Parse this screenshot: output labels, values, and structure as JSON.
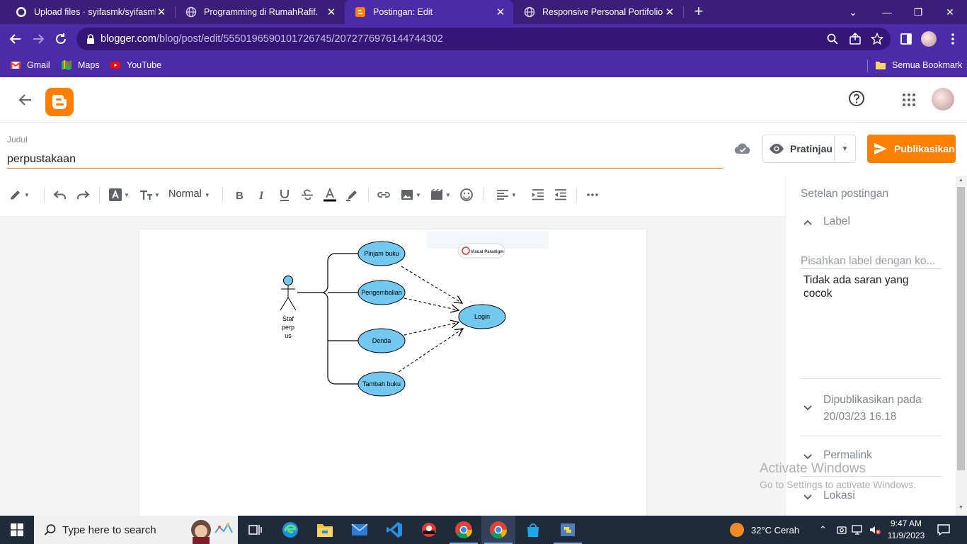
{
  "browser": {
    "tabs": [
      {
        "title": "Upload files · syifasmk/syifasmk",
        "icon": "github-icon",
        "active": false
      },
      {
        "title": "Programming di RumahRafif.",
        "icon": "globe-icon",
        "active": false
      },
      {
        "title": "Postingan: Edit",
        "icon": "blogger-icon",
        "active": true
      },
      {
        "title": "Responsive Personal Portifolio W",
        "icon": "globe-icon",
        "active": false
      }
    ],
    "url_host": "blogger.com",
    "url_path": "/blog/post/edit/5550196590101726745/2072776976144744302",
    "bookmarks": [
      {
        "label": "Gmail",
        "icon": "gmail-icon"
      },
      {
        "label": "Maps",
        "icon": "maps-icon"
      },
      {
        "label": "YouTube",
        "icon": "youtube-icon"
      }
    ],
    "all_bookmarks": "Semua Bookmark"
  },
  "editor": {
    "title_label": "Judul",
    "title_value": "perpustakaan",
    "preview_label": "Pratinjau",
    "publish_label": "Publikasikan",
    "format_label": "Normal",
    "accent": "#ff8000"
  },
  "diagram": {
    "actor": [
      "Staf",
      "perp",
      "us"
    ],
    "use_cases": [
      "Pinjam buku",
      "Pengembalian",
      "Denda",
      "Tambah buku"
    ],
    "target": "Login",
    "watermark": "Visual Paradigm",
    "ellipse_fill": "#72c8ef"
  },
  "sidebar": {
    "heading": "Setelan postingan",
    "label_section": "Label",
    "label_placeholder": "Pisahkan label dengan ko...",
    "no_suggestion": "Tidak ada saran yang cocok",
    "published_title": "Dipublikasikan pada",
    "published_date": "20/03/23 16.18",
    "permalink": "Permalink",
    "location": "Lokasi"
  },
  "activation": {
    "line1": "Activate Windows",
    "line2": "Go to Settings to activate Windows."
  },
  "taskbar": {
    "search_placeholder": "Type here to search",
    "weather": "32°C  Cerah",
    "time": "9:47 AM",
    "date": "11/9/2023"
  }
}
